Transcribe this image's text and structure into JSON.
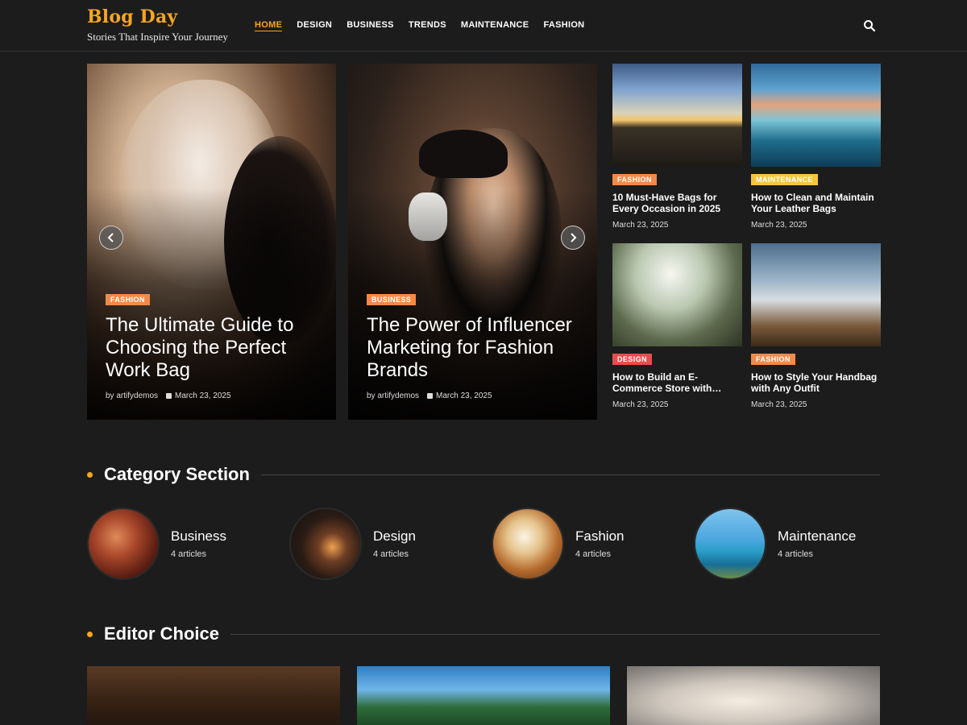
{
  "brand": {
    "title": "Blog Day",
    "tagline": "Stories That Inspire Your Journey"
  },
  "nav": {
    "items": [
      "HOME",
      "DESIGN",
      "BUSINESS",
      "TRENDS",
      "MAINTENANCE",
      "FASHION"
    ],
    "active": "HOME"
  },
  "colors": {
    "accent": "#f5a623",
    "badge_orange": "#f08a4b",
    "badge_yellow": "#f5c542",
    "badge_red": "#e84d4d",
    "background": "#1c1c1c"
  },
  "slides": [
    {
      "category": "FASHION",
      "title": "The Ultimate Guide to Choosing the Perfect Work Bag",
      "author": "by artifydemos",
      "date": "March 23, 2025"
    },
    {
      "category": "BUSINESS",
      "title": "The Power of Influencer Marketing for Fashion Brands",
      "author": "by artifydemos",
      "date": "March 23, 2025"
    }
  ],
  "grid_posts": [
    {
      "category": "FASHION",
      "title": "10 Must-Have Bags for Every Occasion in 2025",
      "date": "March 23, 2025"
    },
    {
      "category": "MAINTENANCE",
      "title": "How to Clean and Maintain Your Leather Bags",
      "date": "March 23, 2025"
    },
    {
      "category": "DESIGN",
      "title": "How to Build an E-Commerce Store with…",
      "date": "March 23, 2025"
    },
    {
      "category": "FASHION",
      "title": "How to Style Your Handbag with Any Outfit",
      "date": "March 23, 2025"
    }
  ],
  "category_section": {
    "title": "Category Section",
    "items": [
      {
        "name": "Business",
        "count": "4 articles"
      },
      {
        "name": "Design",
        "count": "4 articles"
      },
      {
        "name": "Fashion",
        "count": "4 articles"
      },
      {
        "name": "Maintenance",
        "count": "4 articles"
      }
    ]
  },
  "editor_choice": {
    "title": "Editor Choice"
  },
  "icons": {
    "search": "search-icon",
    "prev": "chevron-left-icon",
    "next": "chevron-right-icon",
    "calendar": "calendar-icon"
  }
}
